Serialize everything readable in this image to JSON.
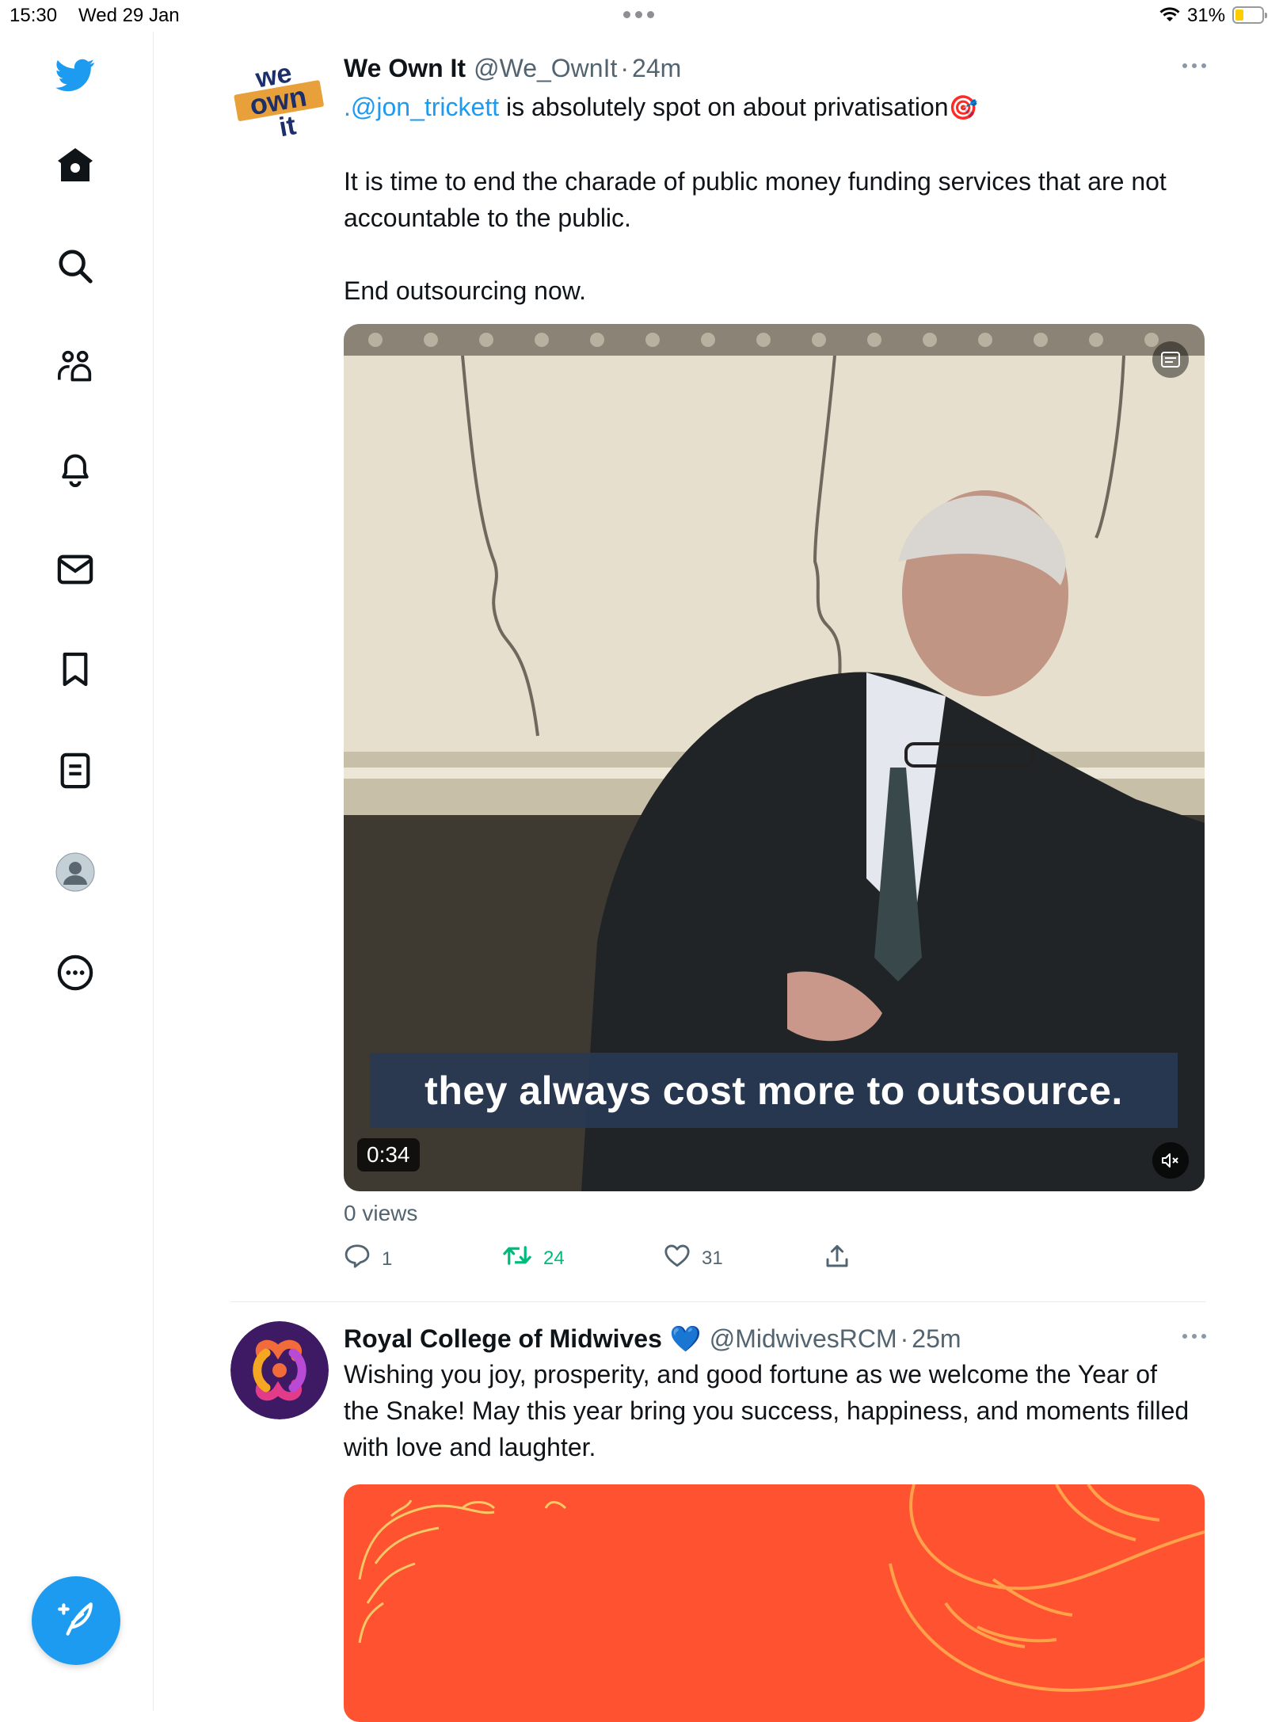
{
  "status_bar": {
    "time": "15:30",
    "date": "Wed 29 Jan",
    "battery_percent": "31%",
    "battery_level": 0.31
  },
  "sidebar": {
    "items": [
      {
        "name": "twitter-logo",
        "icon": "twitter-bird-icon"
      },
      {
        "name": "home",
        "icon": "home-icon"
      },
      {
        "name": "explore",
        "icon": "search-icon"
      },
      {
        "name": "communities",
        "icon": "communities-icon"
      },
      {
        "name": "notifications",
        "icon": "bell-icon"
      },
      {
        "name": "messages",
        "icon": "mail-icon"
      },
      {
        "name": "bookmarks",
        "icon": "bookmark-icon"
      },
      {
        "name": "lists",
        "icon": "list-icon"
      },
      {
        "name": "profile",
        "icon": "avatar-icon"
      },
      {
        "name": "more",
        "icon": "more-circle-icon"
      }
    ],
    "compose_icon": "compose-tweet-icon"
  },
  "colors": {
    "accent": "#1d9bf0",
    "retweet_green": "#00ba7c",
    "text_secondary": "#536471"
  },
  "tweets": [
    {
      "author_name": "We Own It",
      "handle": "@We_OwnIt",
      "separator": "·",
      "time": "24m",
      "avatar_words": [
        "we",
        "own",
        "it"
      ],
      "mention": ".@jon_trickett",
      "line1_rest": " is absolutely spot on about privatisation",
      "emoji": "🎯",
      "paragraph2": "It is time to end the charade of public money funding services that are not accountable to the public.",
      "paragraph3": "End outsourcing now.",
      "video": {
        "caption": "they always cost more to outsource.",
        "duration": "0:34"
      },
      "views": "0 views",
      "stats": {
        "replies": "1",
        "retweets": "24",
        "likes": "31"
      }
    },
    {
      "author_name": "Royal College of Midwives",
      "verified_emoji": "💙",
      "handle": "@MidwivesRCM",
      "separator": "·",
      "time": "25m",
      "text": "Wishing you joy, prosperity, and good fortune as we welcome the Year of the Snake! May this year bring you success, happiness, and moments filled with love and laughter."
    }
  ]
}
